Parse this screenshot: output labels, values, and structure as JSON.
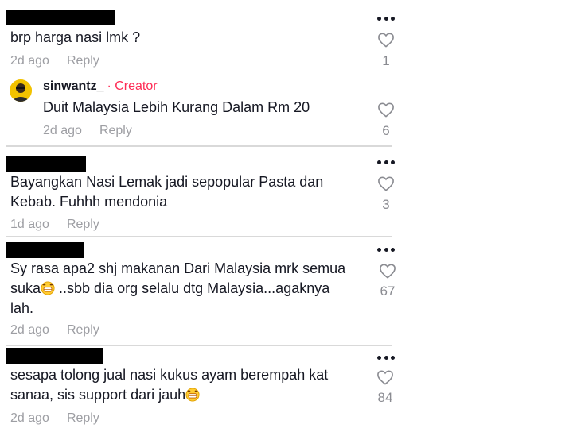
{
  "comments": [
    {
      "text": "brp harga nasi lmk ?",
      "time": "2d ago",
      "reply_label": "Reply",
      "likes": "1"
    },
    {
      "username": "sinwantz_",
      "creator_badge": "· Creator",
      "text": "Duit Malaysia Lebih Kurang Dalam Rm 20",
      "time": "2d ago",
      "reply_label": "Reply",
      "likes": "6"
    },
    {
      "text_lines": [
        "Bayangkan Nasi Lemak jadi sepopular Pasta dan",
        "Kebab. Fuhhh mendonia"
      ],
      "time": "1d ago",
      "reply_label": "Reply",
      "likes": "3"
    },
    {
      "text_lines": [
        "Sy rasa apa2 shj makanan Dari Malaysia mrk semua",
        "suka",
        " ..sbb dia org selalu dtg Malaysia...agaknya",
        "lah."
      ],
      "time": "2d ago",
      "reply_label": "Reply",
      "likes": "67"
    },
    {
      "text_lines": [
        "sesapa tolong jual nasi kukus ayam berempah kat",
        "sanaa, sis support dari jauh"
      ],
      "time": "2d ago",
      "reply_label": "Reply",
      "likes": "84"
    }
  ],
  "icons": {
    "more": "more-options-icon",
    "like": "heart-icon",
    "emoji": "grinning-emoji-icon"
  },
  "colors": {
    "creator": "#fe2c55",
    "meta": "#9d9ea3",
    "text": "#161823"
  }
}
